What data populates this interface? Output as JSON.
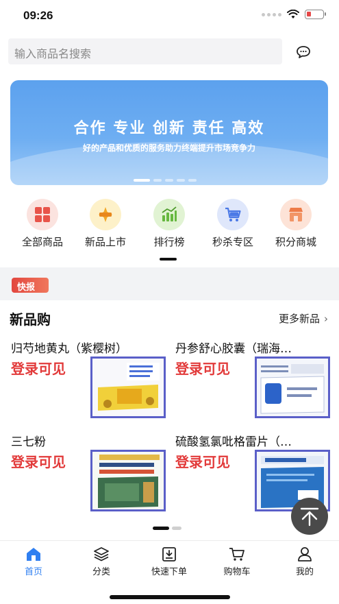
{
  "status_bar": {
    "time": "09:26",
    "battery_level": 0.25
  },
  "search": {
    "placeholder": "输入商品名搜索",
    "message_icon": "chat-bubble-icon"
  },
  "banner": {
    "title": "合作 专业 创新 责任 高效",
    "subtitle": "好的产品和优质的服务助力终端提升市场竞争力",
    "slide_index": 1,
    "slide_count": 5
  },
  "categories": [
    {
      "label": "全部商品",
      "icon": "grid-icon",
      "color": "#fbe3df"
    },
    {
      "label": "新品上市",
      "icon": "new-tag-icon",
      "color": "#fdf1c9"
    },
    {
      "label": "排行榜",
      "icon": "chart-icon",
      "color": "#e1f3d3"
    },
    {
      "label": "秒杀专区",
      "icon": "cart-icon",
      "color": "#dfe7fb"
    },
    {
      "label": "积分商城",
      "icon": "shop-icon",
      "color": "#fde3d7"
    }
  ],
  "news": {
    "badge": "快报"
  },
  "new_products": {
    "title": "新品购",
    "more_label": "更多新品",
    "items": [
      {
        "name": "归芍地黄丸（紫樱树）",
        "price": "登录可见"
      },
      {
        "name": "丹参舒心胶囊（瑞海…",
        "price": "登录可见"
      },
      {
        "name": "三七粉",
        "price": "登录可见"
      },
      {
        "name": "硫酸氢氯吡格雷片（…",
        "price": "登录可见"
      }
    ]
  },
  "tabbar": [
    {
      "label": "首页",
      "icon": "home-icon",
      "active": true
    },
    {
      "label": "分类",
      "icon": "layers-icon",
      "active": false
    },
    {
      "label": "快速下单",
      "icon": "quick-order-icon",
      "active": false
    },
    {
      "label": "购物车",
      "icon": "cart-icon",
      "active": false
    },
    {
      "label": "我的",
      "icon": "user-icon",
      "active": false
    }
  ],
  "colors": {
    "accent": "#2f7ff1",
    "price": "#e23a3a",
    "badge": "#e2473f"
  }
}
